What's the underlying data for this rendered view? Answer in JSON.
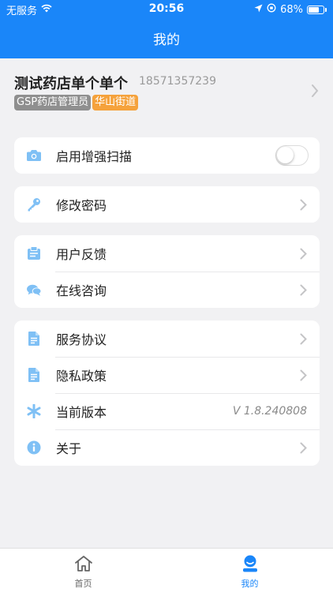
{
  "status_bar": {
    "carrier": "无服务",
    "time": "20:56",
    "battery": "68%"
  },
  "nav": {
    "title": "我的"
  },
  "profile": {
    "name": "测试药店单个单个",
    "phone": "18571357239",
    "role_badge": "GSP药店管理员",
    "area_badge": "华山街道"
  },
  "settings": {
    "scan_label": "启用增强扫描",
    "scan_enabled": false,
    "password_label": "修改密码",
    "feedback_label": "用户反馈",
    "consult_label": "在线咨询",
    "agreement_label": "服务协议",
    "privacy_label": "隐私政策",
    "version_label": "当前版本",
    "version_value": "V 1.8.240808",
    "about_label": "关于"
  },
  "tabbar": {
    "home_label": "首页",
    "mine_label": "我的"
  },
  "colors": {
    "primary": "#1a86f9",
    "icon_blue": "#7fc0f5",
    "badge_gray": "#8f8f8f",
    "badge_orange": "#f5a23c"
  }
}
